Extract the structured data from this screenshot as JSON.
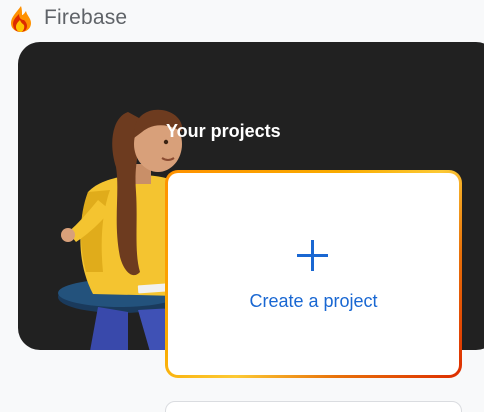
{
  "header": {
    "brand": "Firebase",
    "logo_icon": "firebase-flame-icon"
  },
  "hero": {
    "title": "Your projects",
    "background_color": "#212121",
    "illustration": "person-seated-illustration"
  },
  "create_card": {
    "label": "Create a project",
    "icon": "plus-icon",
    "accent_color": "#1967d2",
    "border_colors": [
      "#ff9100",
      "#f9ab00",
      "#dd2c00"
    ]
  }
}
